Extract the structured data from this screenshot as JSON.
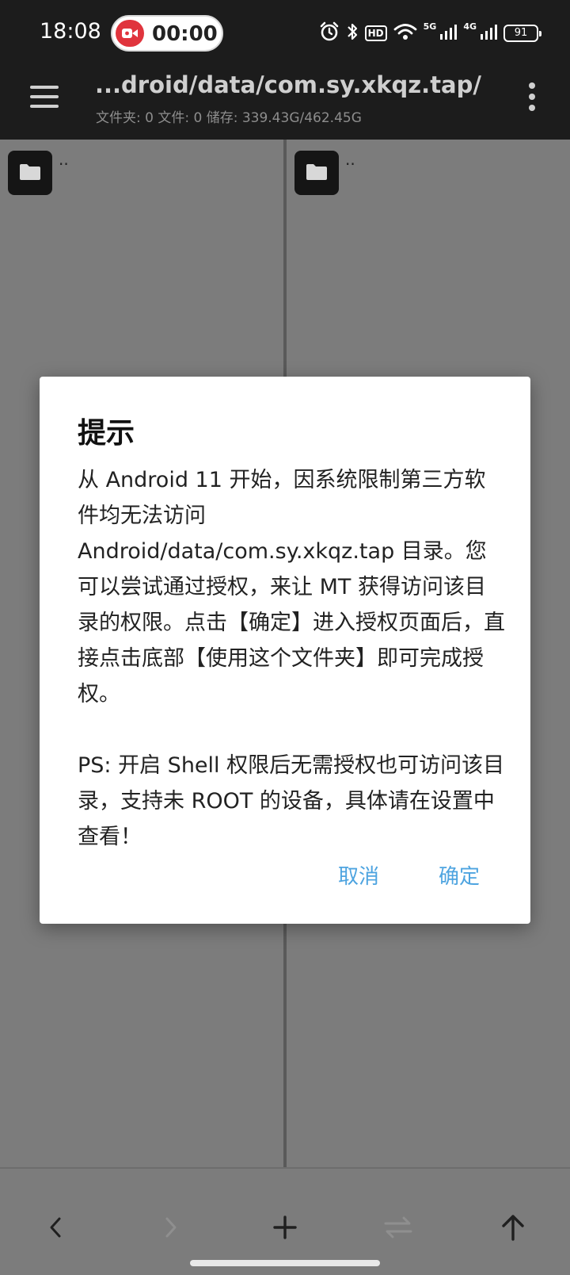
{
  "status_bar": {
    "time": "18:08",
    "recording_time": "00:00",
    "hd_label": "HD",
    "signal1_label": "5G",
    "signal2_label": "4G",
    "battery": "91"
  },
  "toolbar": {
    "path": "...droid/data/com.sy.xkqz.tap/",
    "info": "文件夹: 0  文件: 0  储存: 339.43G/462.45G"
  },
  "left_pane": {
    "folder_name": ".."
  },
  "right_pane": {
    "folder_name": ".."
  },
  "dialog": {
    "title": "提示",
    "paragraph1": "从 Android 11 开始，因系统限制第三方软件均无法访问 Android/data/com.sy.xkqz.tap 目录。您可以尝试通过授权，来让 MT 获得访问该目录的权限。点击【确定】进入授权页面后，直接点击底部【使用这个文件夹】即可完成授权。",
    "paragraph2": "PS: 开启 Shell 权限后无需授权也可访问该目录，支持未 ROOT 的设备，具体请在设置中查看！",
    "cancel_label": "取消",
    "ok_label": "确定"
  },
  "colors": {
    "accent": "#4ea4e0",
    "toolbar_bg": "#1c1c1c",
    "record_red": "#e0343d"
  }
}
